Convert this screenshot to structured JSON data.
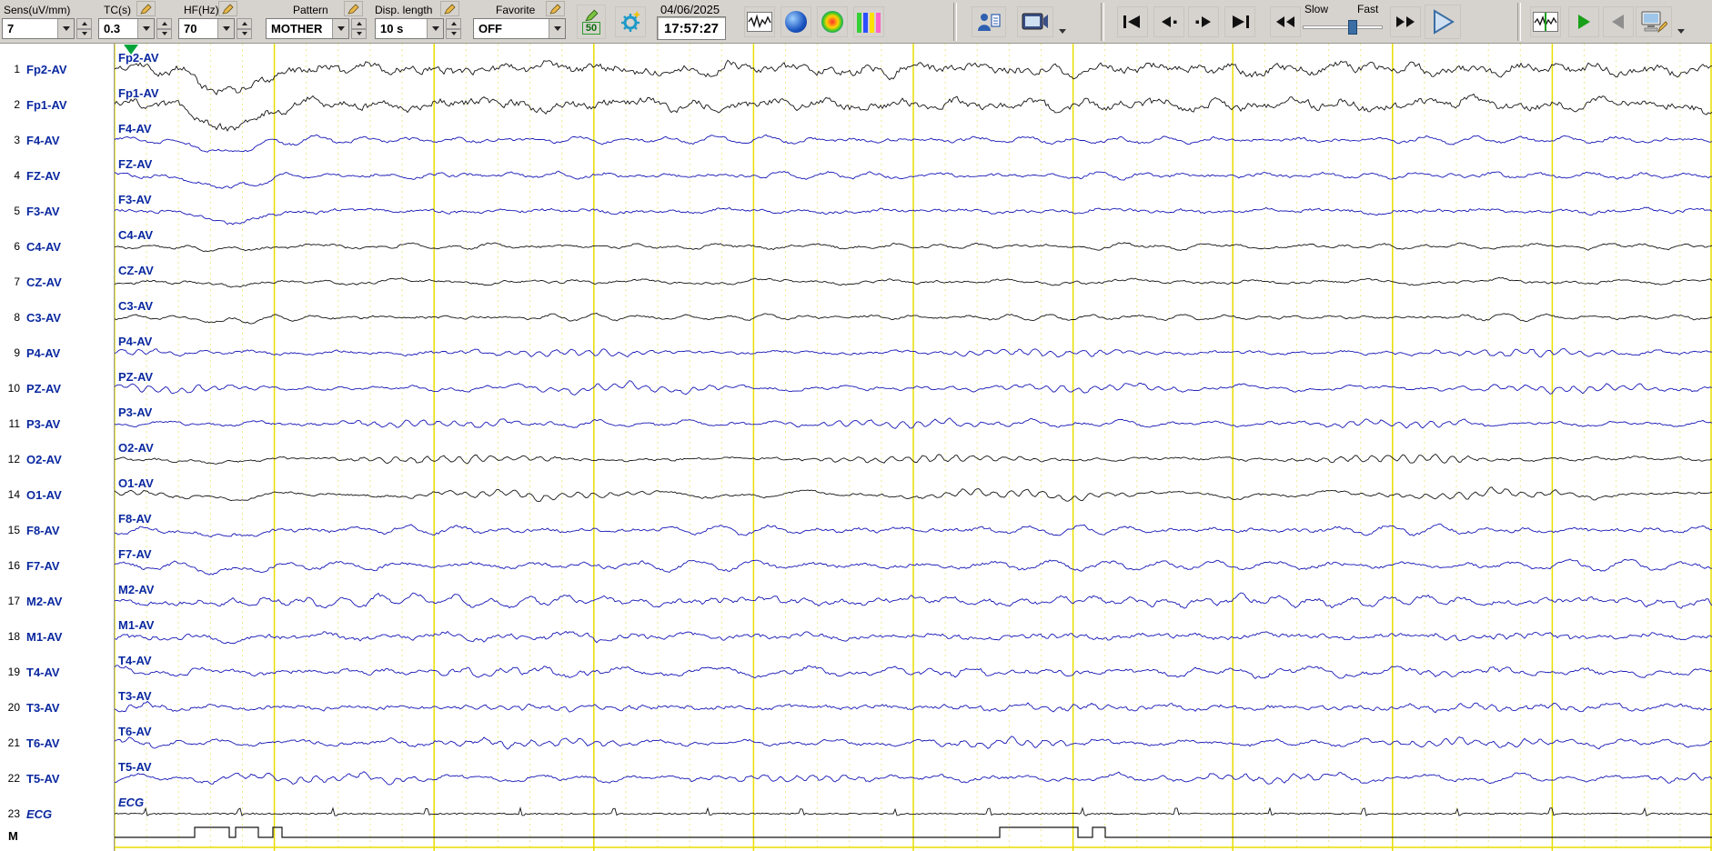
{
  "toolbar": {
    "sens_label": "Sens(uV/mm)",
    "sens_value": "7",
    "tc_label": "TC(s)",
    "tc_value": "0.3",
    "hf_label": "HF(Hz)",
    "hf_value": "70",
    "pattern_label": "Pattern",
    "pattern_value": "MOTHER",
    "disp_label": "Disp. length",
    "disp_value": "10 s",
    "favorite_label": "Favorite",
    "favorite_value": "OFF",
    "pen_value": "50",
    "date": "04/06/2025",
    "time": "17:57:27",
    "slow_label": "Slow",
    "fast_label": "Fast"
  },
  "colors": {
    "trace_black": "#141414",
    "trace_blue": "#1616b6",
    "label_navy": "#0a28a0",
    "grid_major": "#e8dd00",
    "grid_minor": "#efe98e",
    "marker_green": "#00a33a"
  },
  "channels": [
    {
      "num": "1",
      "label": "Fp2-AV",
      "color": "black",
      "kind": "fp"
    },
    {
      "num": "2",
      "label": "Fp1-AV",
      "color": "black",
      "kind": "fp"
    },
    {
      "num": "3",
      "label": "F4-AV",
      "color": "blue",
      "kind": "frontal"
    },
    {
      "num": "4",
      "label": "FZ-AV",
      "color": "blue",
      "kind": "frontal"
    },
    {
      "num": "5",
      "label": "F3-AV",
      "color": "blue",
      "kind": "frontal"
    },
    {
      "num": "6",
      "label": "C4-AV",
      "color": "black",
      "kind": "central"
    },
    {
      "num": "7",
      "label": "CZ-AV",
      "color": "black",
      "kind": "central"
    },
    {
      "num": "8",
      "label": "C3-AV",
      "color": "black",
      "kind": "central"
    },
    {
      "num": "9",
      "label": "P4-AV",
      "color": "blue",
      "kind": "parietal"
    },
    {
      "num": "10",
      "label": "PZ-AV",
      "color": "blue",
      "kind": "parietal"
    },
    {
      "num": "11",
      "label": "P3-AV",
      "color": "blue",
      "kind": "parietal"
    },
    {
      "num": "12",
      "label": "O2-AV",
      "color": "black",
      "kind": "occipital"
    },
    {
      "num": "14",
      "label": "O1-AV",
      "color": "black",
      "kind": "occipital"
    },
    {
      "num": "15",
      "label": "F8-AV",
      "color": "blue",
      "kind": "latfront"
    },
    {
      "num": "16",
      "label": "F7-AV",
      "color": "blue",
      "kind": "latfront"
    },
    {
      "num": "17",
      "label": "M2-AV",
      "color": "blue",
      "kind": "mastoid"
    },
    {
      "num": "18",
      "label": "M1-AV",
      "color": "blue",
      "kind": "mastoid"
    },
    {
      "num": "19",
      "label": "T4-AV",
      "color": "blue",
      "kind": "temporal"
    },
    {
      "num": "20",
      "label": "T3-AV",
      "color": "blue",
      "kind": "temporal"
    },
    {
      "num": "21",
      "label": "T6-AV",
      "color": "blue",
      "kind": "posttemp"
    },
    {
      "num": "22",
      "label": "T5-AV",
      "color": "blue",
      "kind": "posttemp"
    },
    {
      "num": "23",
      "label": "ECG",
      "color": "black",
      "kind": "ecg",
      "italic": true
    }
  ],
  "marker": {
    "label": "M",
    "pulses_s": [
      [
        0.5,
        0.72
      ],
      [
        0.76,
        0.9
      ],
      [
        0.99,
        1.05
      ],
      [
        5.54,
        6.03
      ],
      [
        6.12,
        6.2
      ]
    ]
  },
  "display_seconds": 10
}
